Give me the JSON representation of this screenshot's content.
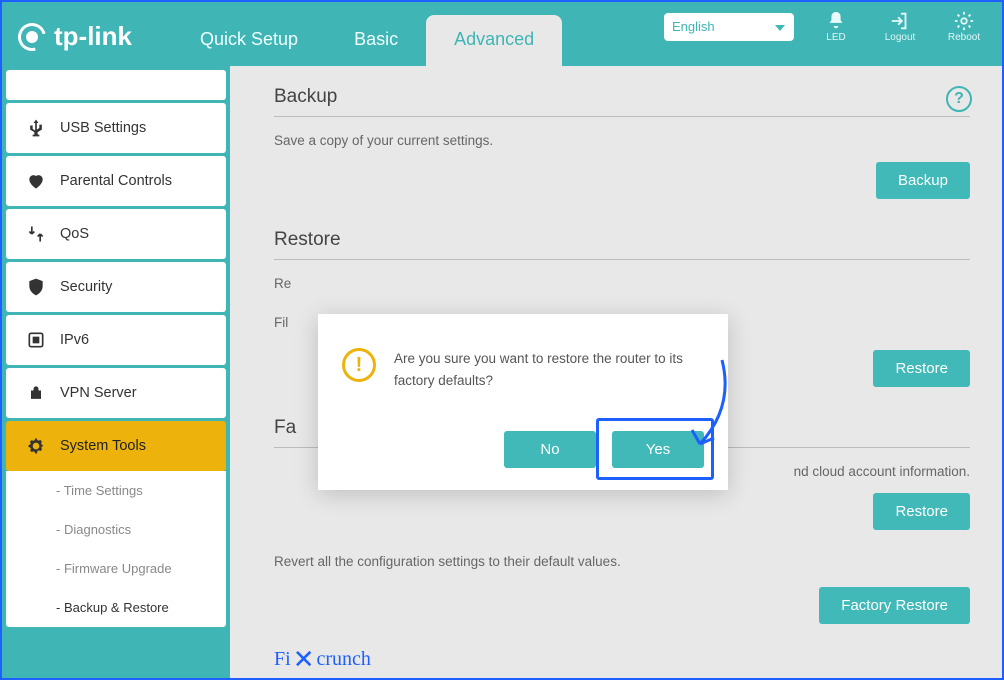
{
  "brand": "tp-link",
  "header": {
    "tabs": {
      "quick": "Quick Setup",
      "basic": "Basic",
      "advanced": "Advanced"
    },
    "language": "English",
    "icons": {
      "led": "LED",
      "logout": "Logout",
      "reboot": "Reboot"
    }
  },
  "sidebar": {
    "items": {
      "usb": "USB Settings",
      "parental": "Parental Controls",
      "qos": "QoS",
      "security": "Security",
      "ipv6": "IPv6",
      "vpn": "VPN Server",
      "systools": "System Tools"
    },
    "subs": {
      "time": "Time Settings",
      "diag": "Diagnostics",
      "fw": "Firmware Upgrade",
      "bkr": "Backup & Restore"
    }
  },
  "content": {
    "help": "?",
    "backup": {
      "title": "Backup",
      "desc": "Save a copy of your current settings.",
      "btn": "Backup"
    },
    "restore": {
      "title": "Restore",
      "line1_prefix": "Re",
      "line2_prefix": "Fil",
      "btn": "Restore"
    },
    "factory": {
      "title_prefix": "Fa",
      "desc_suffix": "nd cloud account information.",
      "restore_btn": "Restore",
      "full_desc": "Revert all the configuration settings to their default values.",
      "factory_btn": "Factory Restore"
    }
  },
  "modal": {
    "message": "Are you sure you want to restore the router to its factory defaults?",
    "no": "No",
    "yes": "Yes"
  },
  "watermark": {
    "a": "Fi",
    "b": "crunch"
  }
}
